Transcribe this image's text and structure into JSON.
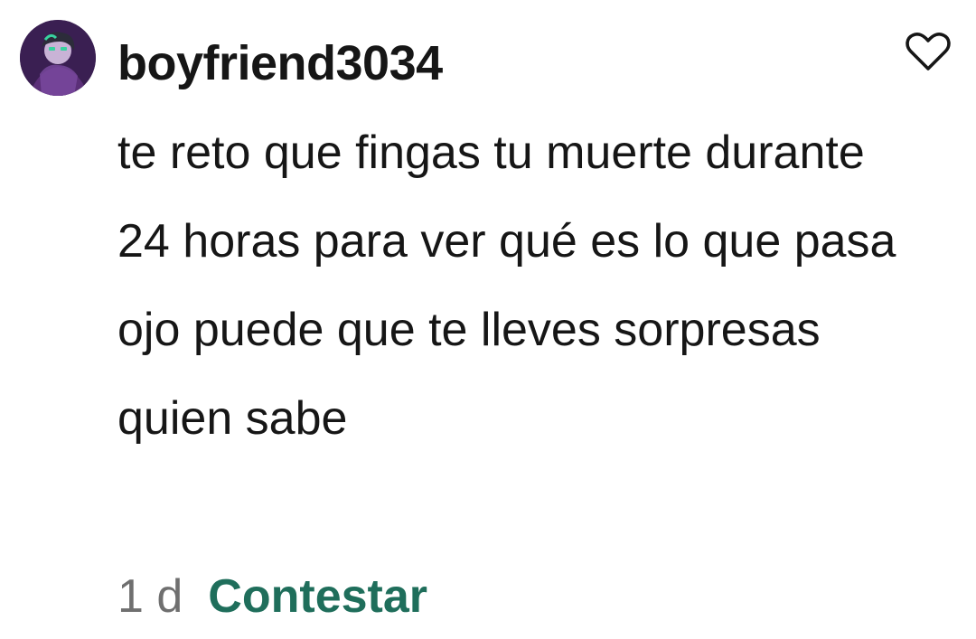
{
  "comment": {
    "username": "boyfriend3034",
    "text": "te reto que fingas tu muerte durante 24 horas para ver qué es lo que pasa ojo puede que te lleves sorpresas quien sabe",
    "timestamp": "1 d",
    "reply_label": "Contestar",
    "like_icon": "heart-outline-icon",
    "avatar_icon": "user-avatar"
  },
  "colors": {
    "text": "#161616",
    "muted": "#6f6f6f",
    "accent": "#1f6e5b",
    "background": "#ffffff"
  }
}
